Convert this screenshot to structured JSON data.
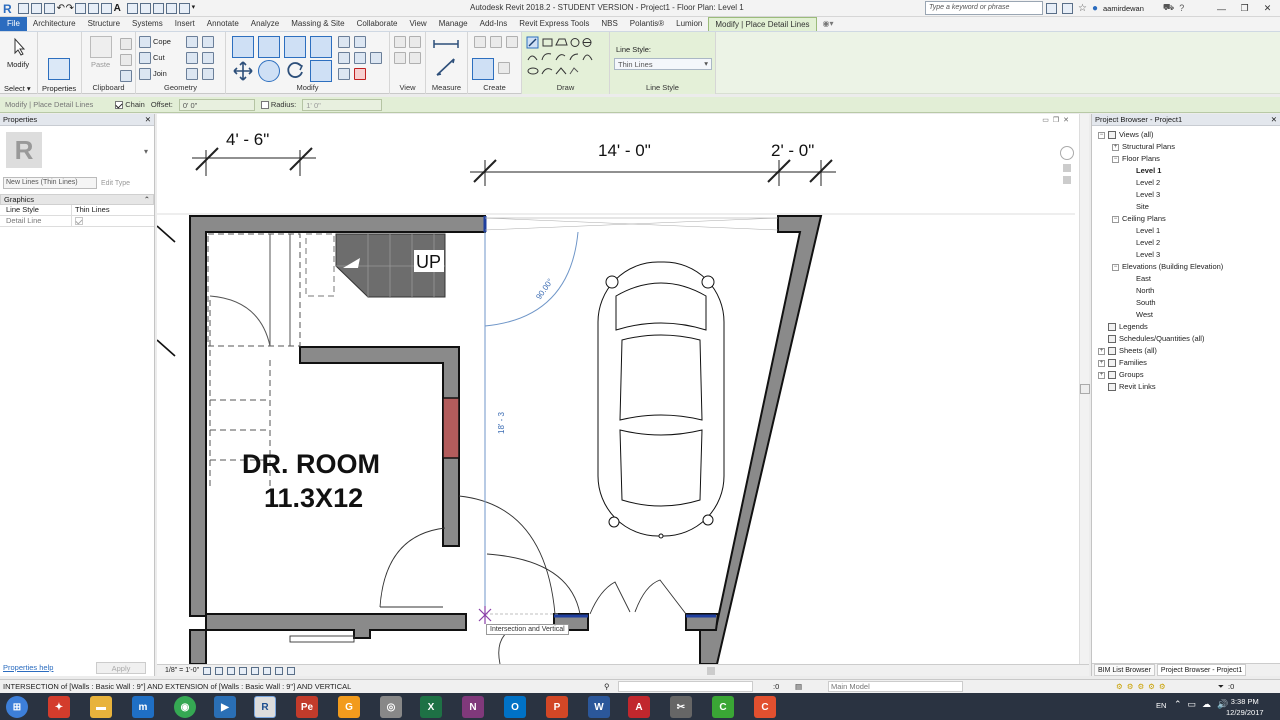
{
  "window": {
    "title": "Autodesk Revit 2018.2 - STUDENT VERSION -    Project1 - Floor Plan: Level 1",
    "search_placeholder": "Type a keyword or phrase",
    "user": "aamirdewan"
  },
  "menu": [
    "File",
    "Architecture",
    "Structure",
    "Systems",
    "Insert",
    "Annotate",
    "Analyze",
    "Massing & Site",
    "Collaborate",
    "View",
    "Manage",
    "Add-Ins",
    "Revit Express Tools",
    "NBS",
    "Polantis®",
    "Lumion",
    "Modify | Place Detail Lines"
  ],
  "ribbon": {
    "modify_label": "Modify",
    "select_label": "Select ▾",
    "properties_label": "Properties",
    "paste_label": "Paste",
    "clipboard_label": "Clipboard",
    "cope_label": "Cope",
    "cut_label": "Cut",
    "join_label": "Join",
    "geometry_label": "Geometry",
    "modify_group_label": "Modify",
    "view_label": "View",
    "measure_label": "Measure",
    "create_label": "Create",
    "draw_label": "Draw",
    "line_style_caption": "Line Style:",
    "line_style_value": "Thin Lines",
    "line_style_group": "Line Style"
  },
  "options_bar": {
    "context": "Modify | Place Detail Lines",
    "chain_label": "Chain",
    "chain_checked": true,
    "offset_label": "Offset:",
    "offset_value": "0'  0\"",
    "radius_label": "Radius:",
    "radius_value": "1'  0\"",
    "radius_checked": false
  },
  "properties": {
    "title": "Properties",
    "type_selector": "New Lines (Thin Lines)",
    "edit_type": "Edit Type",
    "section": "Graphics",
    "rows": [
      {
        "name": "Line Style",
        "value": "Thin Lines"
      },
      {
        "name": "Detail Line",
        "value": ""
      }
    ],
    "help": "Properties help",
    "apply": "Apply"
  },
  "drawing": {
    "dim1": "4' - 6\"",
    "dim2": "14' - 0\"",
    "dim3": "2' - 0\"",
    "stair_label": "UP",
    "room_name": "DR. ROOM",
    "room_size": "11.3X12",
    "angle": "90.00°",
    "temp_dim": "18' - 3",
    "snap_tooltip": "Intersection and Vertical"
  },
  "project_browser": {
    "title": "Project Browser - Project1",
    "tree": [
      {
        "label": "Views (all)",
        "level": 0,
        "tw": "−"
      },
      {
        "label": "Structural Plans",
        "level": 1,
        "tw": "+"
      },
      {
        "label": "Floor Plans",
        "level": 1,
        "tw": "−"
      },
      {
        "label": "Level 1",
        "level": 2,
        "bold": true
      },
      {
        "label": "Level 2",
        "level": 2
      },
      {
        "label": "Level 3",
        "level": 2
      },
      {
        "label": "Site",
        "level": 2
      },
      {
        "label": "Ceiling Plans",
        "level": 1,
        "tw": "−"
      },
      {
        "label": "Level 1",
        "level": 2
      },
      {
        "label": "Level 2",
        "level": 2
      },
      {
        "label": "Level 3",
        "level": 2
      },
      {
        "label": "Elevations (Building Elevation)",
        "level": 1,
        "tw": "−"
      },
      {
        "label": "East",
        "level": 2
      },
      {
        "label": "North",
        "level": 2
      },
      {
        "label": "South",
        "level": 2
      },
      {
        "label": "West",
        "level": 2
      },
      {
        "label": "Legends",
        "level": 0,
        "icon": true
      },
      {
        "label": "Schedules/Quantities (all)",
        "level": 0,
        "icon": true
      },
      {
        "label": "Sheets (all)",
        "level": 0,
        "icon": true,
        "tw": "+"
      },
      {
        "label": "Families",
        "level": 0,
        "icon": true,
        "tw": "+"
      },
      {
        "label": "Groups",
        "level": 0,
        "icon": true,
        "tw": "+"
      },
      {
        "label": "Revit Links",
        "level": 0,
        "icon": true
      }
    ],
    "tab1": "BIM List Browser",
    "tab2": "Project Browser - Project1"
  },
  "view_bar": {
    "scale": "1/8\" = 1'-0\""
  },
  "status": {
    "message": "INTERSECTION  of [Walls : Basic Wall : 9\"] AND EXTENSION  of [Walls : Basic Wall : 9\"] AND VERTICAL",
    "count": ":0",
    "model": "Main Model",
    "filter_count": ":0"
  },
  "taskbar": {
    "lang": "EN",
    "time": "3:38 PM",
    "date": "12/29/2017"
  },
  "colors": {
    "accent": "#2b6cbf",
    "context_tab": "#e2f0d4",
    "wall": "#8a8a8a",
    "taskbar": "#2a3341"
  }
}
